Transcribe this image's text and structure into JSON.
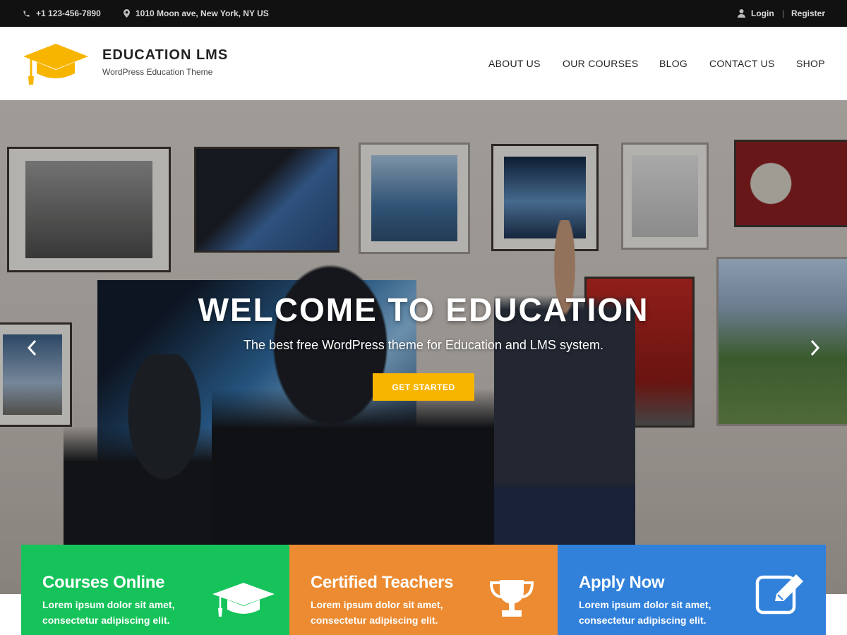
{
  "topbar": {
    "phone": "+1 123-456-7890",
    "address": "1010 Moon ave, New York, NY US",
    "login": "Login",
    "separator": "|",
    "register": "Register",
    "icons": [
      "phone-icon",
      "map-pin-icon",
      "user-icon"
    ]
  },
  "header": {
    "brand_title": "EDUCATION LMS",
    "brand_subtitle": "WordPress Education Theme",
    "logo_icon": "graduation-cap-icon",
    "logo_color": "#f7b500",
    "nav": [
      {
        "label": "ABOUT US"
      },
      {
        "label": "OUR COURSES"
      },
      {
        "label": "BLOG"
      },
      {
        "label": "CONTACT US"
      },
      {
        "label": "SHOP"
      }
    ]
  },
  "hero": {
    "title": "WELCOME TO EDUCATION",
    "subtitle": "The best free WordPress theme for Education and LMS system.",
    "button_label": "GET STARTED",
    "button_color": "#f7b500",
    "prev_icon": "chevron-left-icon",
    "next_icon": "chevron-right-icon"
  },
  "features": [
    {
      "title": "Courses Online",
      "text": "Lorem ipsum dolor sit amet, consectetur adipiscing elit.",
      "icon": "graduation-cap-icon",
      "color": "#16c35a"
    },
    {
      "title": "Certified Teachers",
      "text": "Lorem ipsum dolor sit amet, consectetur adipiscing elit.",
      "icon": "trophy-icon",
      "color": "#ec8b31"
    },
    {
      "title": "Apply Now",
      "text": "Lorem ipsum dolor sit amet, consectetur adipiscing elit.",
      "icon": "edit-icon",
      "color": "#3181db"
    }
  ]
}
